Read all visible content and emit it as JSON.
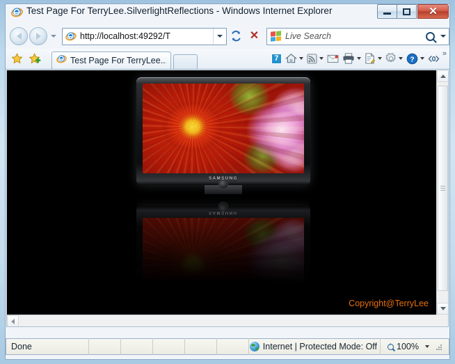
{
  "window": {
    "title": "Test Page For TerryLee.SilverlightReflections - Windows Internet Explorer",
    "app_icon": "ie-icon",
    "minimize_label": "",
    "maximize_label": "",
    "close_label": "✕"
  },
  "navigation": {
    "back_label": "Back",
    "forward_label": "Forward",
    "recent_pages_label": "Recent Pages",
    "address": {
      "url": "http://localhost:49292/T",
      "icon": "ie-icon",
      "dropdown_label": "Address dropdown"
    },
    "refresh_label": "Refresh",
    "stop_label": "✕"
  },
  "search": {
    "placeholder": "Live Search",
    "provider_icon": "windows-logo-icon",
    "go_label": "Search",
    "dropdown_label": "Search options"
  },
  "favorites": {
    "favorites_center_label": "Favorites Center",
    "add_to_favorites_label": "Add to Favorites"
  },
  "tabs": [
    {
      "label": "Test Page For TerryLee....",
      "icon": "ie-icon",
      "active": true
    }
  ],
  "new_tab_label": "New Tab",
  "command_bar": {
    "items": [
      {
        "name": "ie7-badge",
        "label": "7",
        "caret": false
      },
      {
        "name": "home-icon",
        "label": "Home",
        "caret": true
      },
      {
        "name": "rss-feed-icon",
        "label": "Feeds",
        "caret": true
      },
      {
        "name": "mail-icon",
        "label": "Read Mail",
        "caret": false
      },
      {
        "name": "print-icon",
        "label": "Print",
        "caret": true
      },
      {
        "name": "page-icon",
        "label": "Page",
        "caret": true
      },
      {
        "name": "tools-gear-icon",
        "label": "Tools",
        "caret": true
      },
      {
        "name": "help-icon",
        "label": "Help",
        "caret": true
      },
      {
        "name": "code-icon",
        "label": "Developer",
        "caret": false
      }
    ],
    "overflow_label": "»"
  },
  "page": {
    "background_color": "#000000",
    "copyright": "Copyright@TerryLee",
    "copyright_color": "#e8700f",
    "media": {
      "device_brand": "SAMSUNG",
      "description": "Flat panel television displaying a close-up photograph of a red dahlia flower beside a pink dahlia with green leaves, with a mirrored reflection beneath"
    }
  },
  "scrollbars": {
    "vertical_up_label": "Scroll up",
    "vertical_down_label": "Scroll down",
    "horizontal_left_label": "Scroll left"
  },
  "status_bar": {
    "status_text": "Done",
    "zone_text": "Internet | Protected Mode: Off",
    "zone_icon": "internet-globe-icon",
    "zoom_level": "100%",
    "zoom_dropdown_label": "Change zoom level"
  }
}
